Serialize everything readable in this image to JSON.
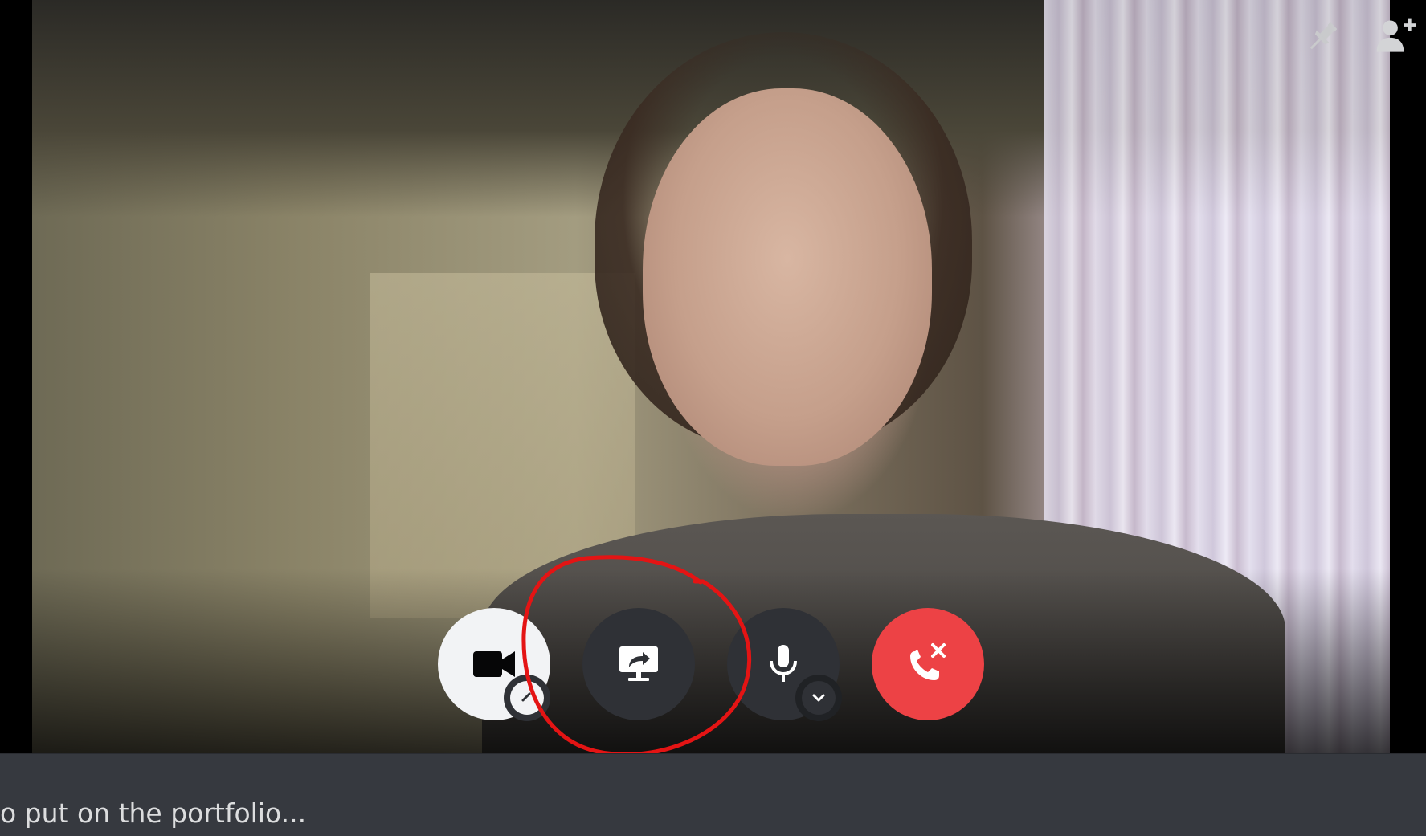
{
  "video": {
    "participant_feed": "camera-video"
  },
  "top_bar": {
    "pin_icon": "pin-icon",
    "add_user_icon": "add-user-icon"
  },
  "controls": {
    "camera": {
      "icon": "video-camera-icon",
      "state": "on",
      "badge_icon": "chevron-icon"
    },
    "share_screen": {
      "icon": "screen-share-icon",
      "highlighted": true
    },
    "microphone": {
      "icon": "microphone-icon",
      "badge_icon": "chevron-down-icon"
    },
    "leave_call": {
      "icon": "hang-up-icon"
    }
  },
  "colors": {
    "control_dark": "#2f3136",
    "control_light": "#f2f3f5",
    "danger": "#ed4245",
    "annotation_red": "#e41414",
    "chat_bg": "#36393f",
    "chat_text": "#dcddde"
  },
  "chat": {
    "preview_text": "o put on the portfolio..."
  }
}
